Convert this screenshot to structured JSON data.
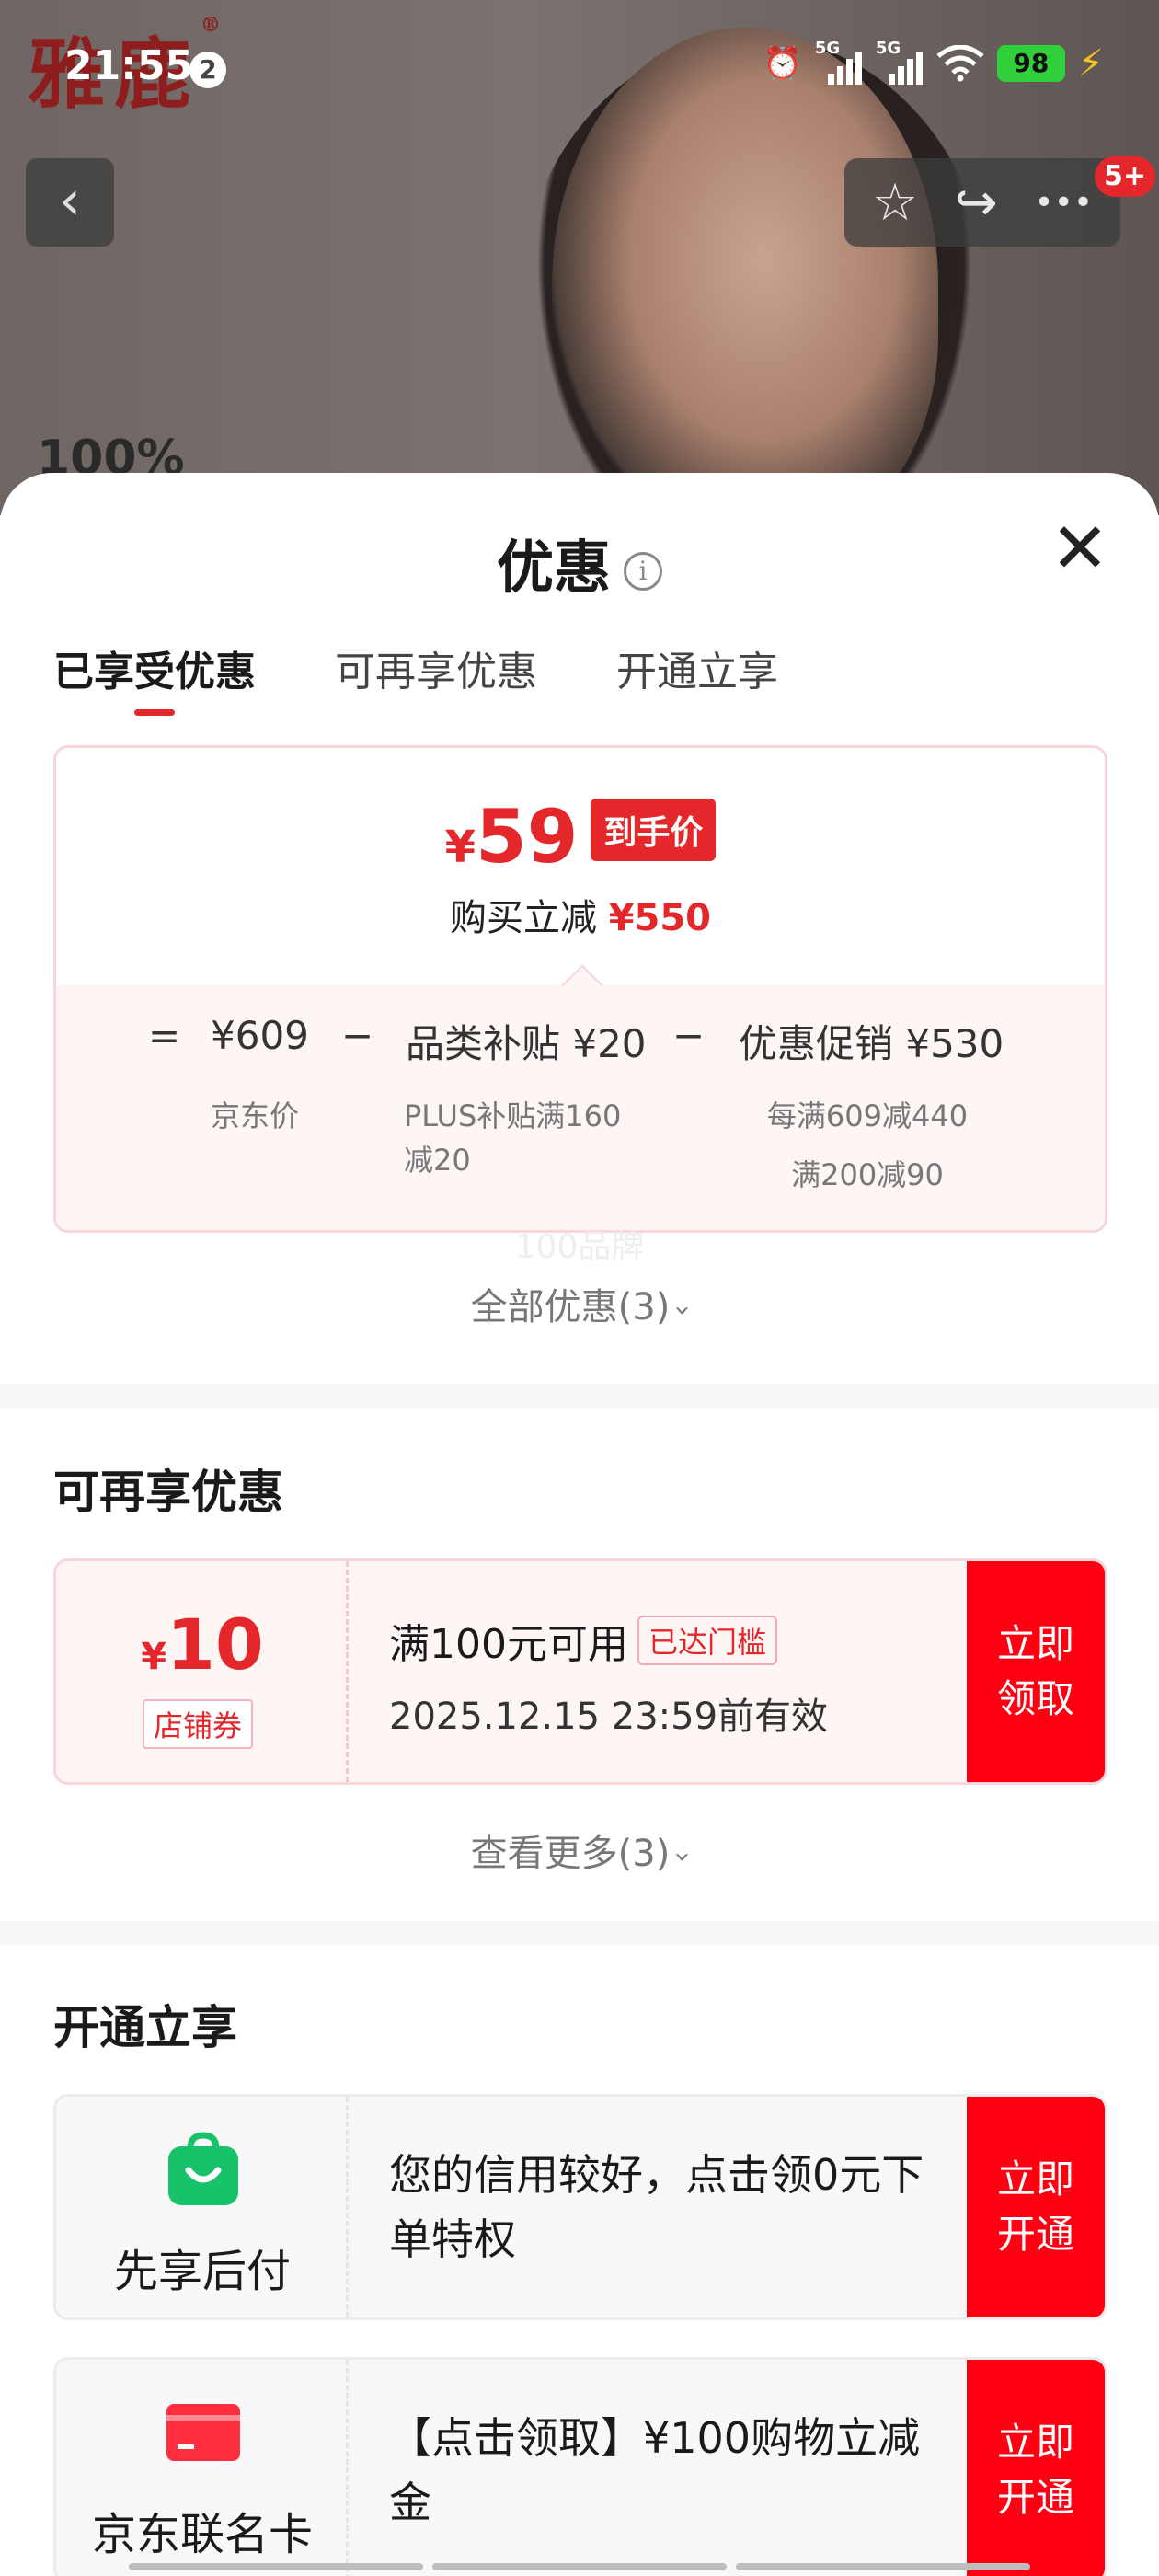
{
  "status_bar": {
    "time": "21:55",
    "notification_count": "2",
    "signal_1": "5G",
    "signal_2": "5G",
    "battery": "98"
  },
  "background": {
    "brand": "雅鹿",
    "brand_mark": "®",
    "percent_text": "100%"
  },
  "top_nav": {
    "back": "‹",
    "favorite": "☆",
    "share": "↪",
    "more": "•••",
    "cart_badge": "5+"
  },
  "sheet": {
    "title": "优惠",
    "info_icon": "i",
    "close": "✕",
    "tabs": [
      "已享受优惠",
      "可再享优惠",
      "开通立享"
    ],
    "price_card": {
      "yen": "¥",
      "final_price": "59",
      "price_tag": "到手价",
      "sub_label": "购买立减",
      "sub_amount": "¥550",
      "eq": "=",
      "jd_price": "¥609",
      "minus_1": "−",
      "item_2": "品类补贴 ¥20",
      "minus_2": "−",
      "item_3": "优惠促销 ¥530",
      "jd_price_label": "京东价",
      "item_2_note_1": "PLUS补贴满160",
      "item_2_note_2": "减20",
      "item_3_note_1": "每满609减440",
      "item_3_note_2": "满200减90"
    },
    "watermark": "100品牌",
    "all_offers_link": "全部优惠(3)",
    "section_more": {
      "title": "可再享优惠",
      "coupon": {
        "yen": "¥",
        "amount": "10",
        "type": "店铺券",
        "condition": "满100元可用",
        "badge": "已达门槛",
        "validity": "2025.12.15 23:59前有效",
        "button": "立即领取"
      },
      "more_link": "查看更多(3)"
    },
    "section_open": {
      "title": "开通立享",
      "cards": [
        {
          "name": "先享后付",
          "icon": "shopping-bag-icon",
          "desc": "您的信用较好，点击领0元下单特权",
          "button": "立即开通"
        },
        {
          "name": "京东联名卡",
          "icon": "credit-card-icon",
          "desc": "【点击领取】¥100购物立减金",
          "button": "立即开通"
        }
      ]
    }
  },
  "colors": {
    "accent_red": "#e4272b",
    "button_red": "#ff0012",
    "bag_green": "#17c26b"
  }
}
